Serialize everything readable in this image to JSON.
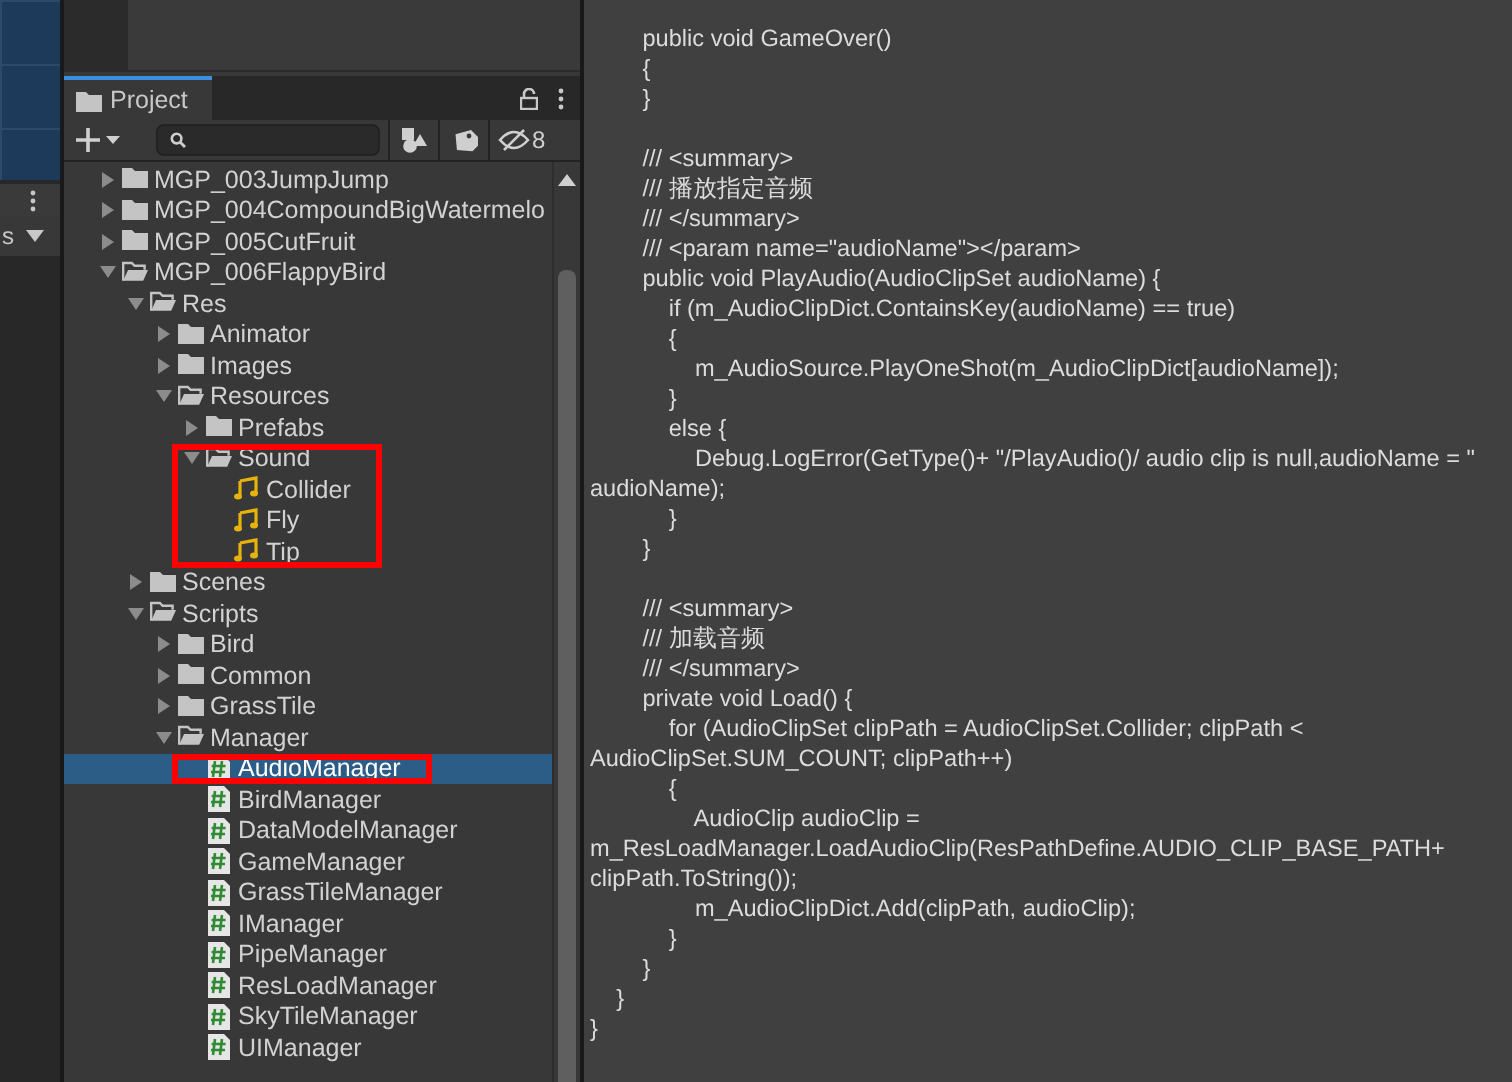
{
  "left_panel": {
    "label": "s"
  },
  "project": {
    "tab": {
      "label": "Project",
      "selected": true
    },
    "toolbar": {
      "hidden_count": "8"
    },
    "tree": [
      {
        "label": "MGP_003JumpJump",
        "kind": "folder",
        "expanded": false,
        "selected": false,
        "boxed": false
      },
      {
        "label": "MGP_004CompoundBigWatermelo",
        "kind": "folder",
        "expanded": false,
        "selected": false,
        "boxed": false
      },
      {
        "label": "MGP_005CutFruit",
        "kind": "folder",
        "expanded": false,
        "selected": false,
        "boxed": false
      },
      {
        "label": "MGP_006FlappyBird",
        "kind": "folder",
        "expanded": true,
        "selected": false,
        "boxed": false,
        "children": [
          {
            "label": "Res",
            "kind": "folder",
            "expanded": true,
            "selected": false,
            "boxed": false,
            "children": [
              {
                "label": "Animator",
                "kind": "folder",
                "expanded": false,
                "selected": false,
                "boxed": false
              },
              {
                "label": "Images",
                "kind": "folder",
                "expanded": false,
                "selected": false,
                "boxed": false
              },
              {
                "label": "Resources",
                "kind": "folder",
                "expanded": true,
                "selected": false,
                "boxed": false,
                "children": [
                  {
                    "label": "Prefabs",
                    "kind": "folder",
                    "expanded": false,
                    "selected": false,
                    "boxed": false
                  },
                  {
                    "label": "Sound",
                    "kind": "folder",
                    "expanded": true,
                    "selected": false,
                    "boxed": true,
                    "children": [
                      {
                        "label": "Collider",
                        "kind": "audio",
                        "selected": false,
                        "boxed": false
                      },
                      {
                        "label": "Fly",
                        "kind": "audio",
                        "selected": false,
                        "boxed": false
                      },
                      {
                        "label": "Tip",
                        "kind": "audio",
                        "selected": false,
                        "boxed": false
                      }
                    ]
                  }
                ]
              }
            ]
          },
          {
            "label": "Scenes",
            "kind": "folder",
            "expanded": false,
            "selected": false,
            "boxed": false
          },
          {
            "label": "Scripts",
            "kind": "folder",
            "expanded": true,
            "selected": false,
            "boxed": false,
            "children": [
              {
                "label": "Bird",
                "kind": "folder",
                "expanded": false,
                "selected": false,
                "boxed": false
              },
              {
                "label": "Common",
                "kind": "folder",
                "expanded": false,
                "selected": false,
                "boxed": false
              },
              {
                "label": "GrassTile",
                "kind": "folder",
                "expanded": false,
                "selected": false,
                "boxed": false
              },
              {
                "label": "Manager",
                "kind": "folder",
                "expanded": true,
                "selected": false,
                "boxed": false,
                "children": [
                  {
                    "label": "AudioManager",
                    "kind": "script",
                    "selected": true,
                    "boxed": true
                  },
                  {
                    "label": "BirdManager",
                    "kind": "script",
                    "selected": false,
                    "boxed": false
                  },
                  {
                    "label": "DataModelManager",
                    "kind": "script",
                    "selected": false,
                    "boxed": false
                  },
                  {
                    "label": "GameManager",
                    "kind": "script",
                    "selected": false,
                    "boxed": false
                  },
                  {
                    "label": "GrassTileManager",
                    "kind": "script",
                    "selected": false,
                    "boxed": false
                  },
                  {
                    "label": "IManager",
                    "kind": "script",
                    "selected": false,
                    "boxed": false
                  },
                  {
                    "label": "PipeManager",
                    "kind": "script",
                    "selected": false,
                    "boxed": false
                  },
                  {
                    "label": "ResLoadManager",
                    "kind": "script",
                    "selected": false,
                    "boxed": false
                  },
                  {
                    "label": "SkyTileManager",
                    "kind": "script",
                    "selected": false,
                    "boxed": false
                  },
                  {
                    "label": "UIManager",
                    "kind": "script",
                    "selected": false,
                    "boxed": false
                  }
                ]
              }
            ]
          }
        ]
      }
    ]
  },
  "code": {
    "blocks": [
      [
        "        public void GameOver()",
        "        {",
        "        }"
      ],
      [
        "        /// <summary>",
        "        /// 播放指定音频",
        "        /// </summary>",
        "        /// <param name=\"audioName\"></param>",
        "        public void PlayAudio(AudioClipSet audioName) {",
        "            if (m_AudioClipDict.ContainsKey(audioName) == true)",
        "            {",
        "                m_AudioSource.PlayOneShot(m_AudioClipDict[audioName]);",
        "            }",
        "            else {",
        "                Debug.LogError(GetType()+ \"/PlayAudio()/ audio clip is null,audioName = \"",
        "audioName);",
        "            }",
        "        }"
      ],
      [
        "        /// <summary>",
        "        /// 加载音频",
        "        /// </summary>",
        "        private void Load() {",
        "            for (AudioClipSet clipPath = AudioClipSet.Collider; clipPath <",
        "AudioClipSet.SUM_COUNT; clipPath++)",
        "            {",
        "                AudioClip audioClip =",
        "m_ResLoadManager.LoadAudioClip(ResPathDefine.AUDIO_CLIP_BASE_PATH+",
        "clipPath.ToString());",
        "                m_AudioClipDict.Add(clipPath, audioClip);",
        "            }",
        "        }",
        "    }",
        "}"
      ]
    ]
  }
}
